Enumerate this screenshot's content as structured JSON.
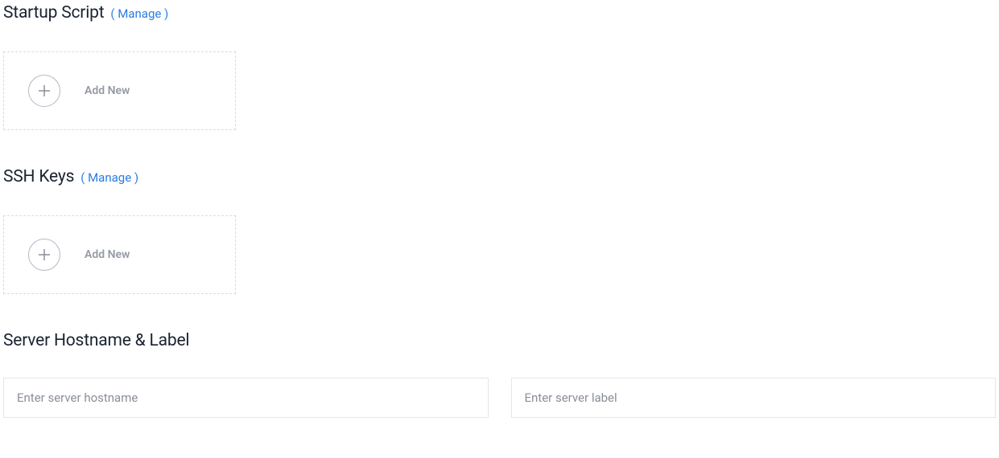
{
  "sections": {
    "startup_script": {
      "title": "Startup Script",
      "manage_label": "( Manage )",
      "add_new_label": "Add New"
    },
    "ssh_keys": {
      "title": "SSH Keys",
      "manage_label": "( Manage )",
      "add_new_label": "Add New"
    },
    "hostname": {
      "title": "Server Hostname & Label",
      "hostname_placeholder": "Enter server hostname",
      "label_placeholder": "Enter server label"
    }
  }
}
